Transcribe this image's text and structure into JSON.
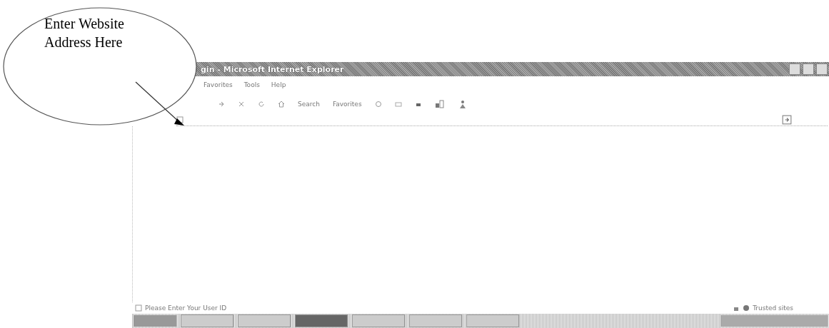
{
  "annotation": {
    "text": "Enter Website Address Here"
  },
  "window": {
    "title": "gin - Microsoft Internet Explorer"
  },
  "menu": [
    "Favorites",
    "Tools",
    "Help"
  ],
  "toolbar": {
    "search": "Search",
    "favorites": "Favorites"
  },
  "status_bar": {
    "text": "Please Enter Your User ID",
    "zone": "Trusted sites"
  },
  "taskbar": {
    "items": [
      {
        "selected": false
      },
      {
        "selected": false
      },
      {
        "selected": true
      },
      {
        "selected": false
      },
      {
        "selected": false
      },
      {
        "selected": false
      }
    ]
  }
}
